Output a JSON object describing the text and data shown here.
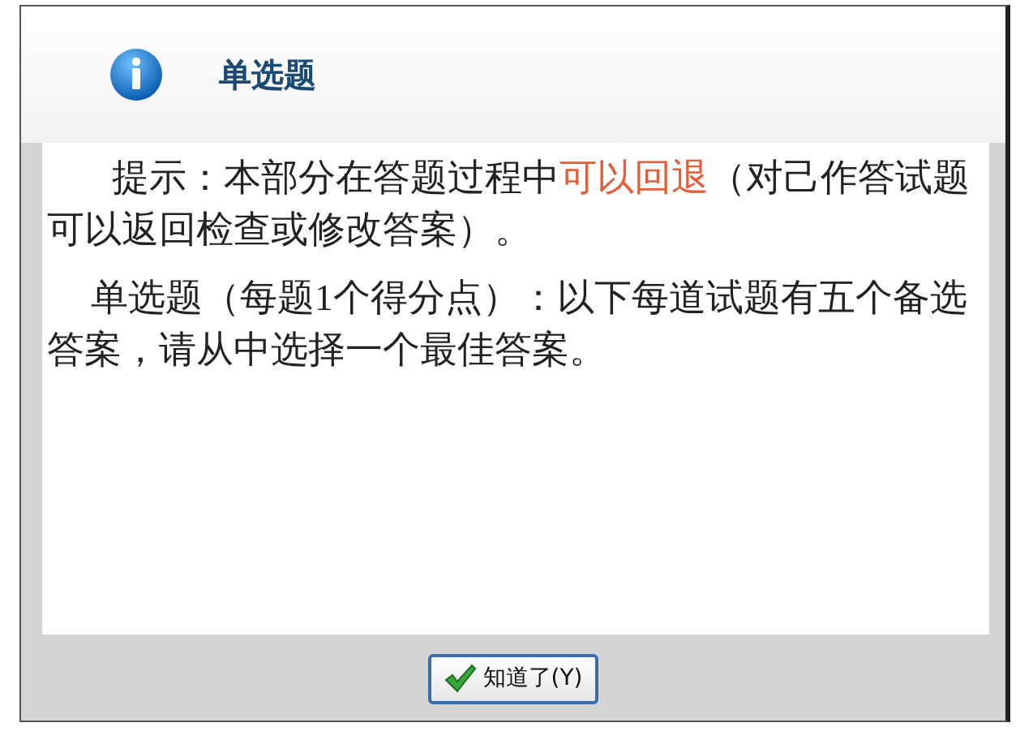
{
  "dialog": {
    "title": "单选题",
    "paragraphs": [
      {
        "segments": [
          {
            "text": "提示：本部分在答题过程中",
            "highlight": false
          },
          {
            "text": "可以回退",
            "highlight": true
          },
          {
            "text": "（对己作答试题可以返回检查或修改答案）。",
            "highlight": false
          }
        ]
      },
      {
        "segments": [
          {
            "text": "单选题（每题1个得分点）：以下每道试题有五个备选答案，请从中选择一个最佳答案。",
            "highlight": false
          }
        ]
      }
    ],
    "button": {
      "label": "知道了(Y)"
    }
  }
}
